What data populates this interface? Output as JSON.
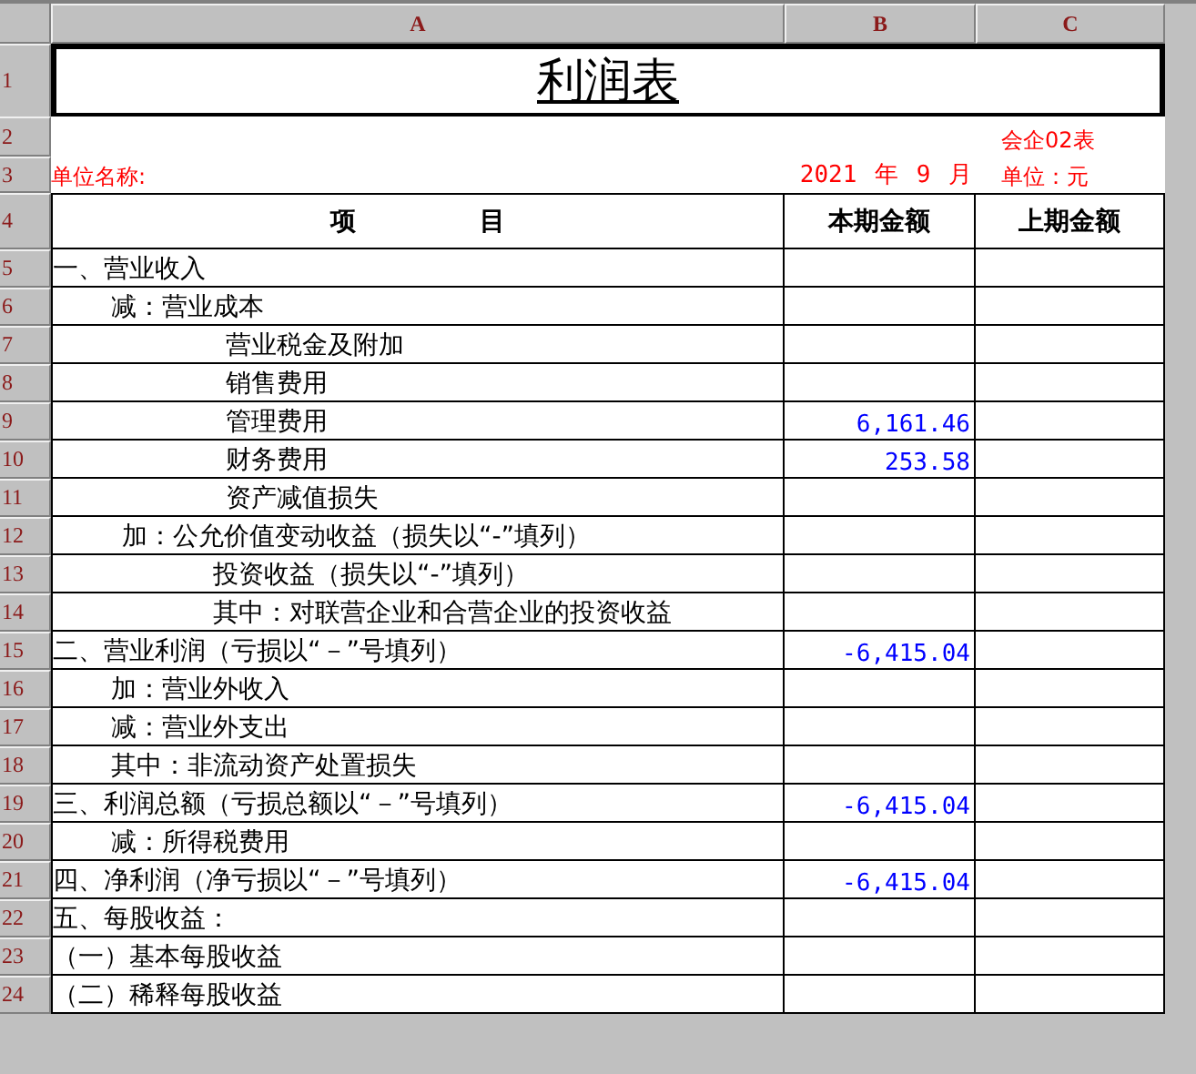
{
  "sheet": {
    "columns": [
      "A",
      "B",
      "C"
    ],
    "title_row": {
      "number": "1",
      "text": "利润表"
    },
    "form_row": {
      "number": "2",
      "form_code": "会企02表"
    },
    "info_row": {
      "number": "3",
      "company_label": "单位名称:",
      "period": "2021 年 9 月",
      "unit": "单位：元"
    },
    "header_row": {
      "number": "4",
      "item": "项 目",
      "current": "本期金额",
      "previous": "上期金额"
    },
    "rows": [
      {
        "number": "5",
        "kind": "heading",
        "item": "一、营业收入"
      },
      {
        "number": "6",
        "kind": "sub",
        "item": "减：营业成本"
      },
      {
        "number": "7",
        "kind": "detail",
        "item": "营业税金及附加"
      },
      {
        "number": "8",
        "kind": "detail",
        "item": "销售费用"
      },
      {
        "number": "9",
        "kind": "detail",
        "item": "管理费用",
        "current": "6,161.46"
      },
      {
        "number": "10",
        "kind": "detail",
        "item": "财务费用",
        "current": "253.58"
      },
      {
        "number": "11",
        "kind": "detail",
        "item": "资产减值损失"
      },
      {
        "number": "12",
        "kind": "adjust",
        "item": "加：公允价值变动收益（损失以“-”填列）"
      },
      {
        "number": "13",
        "kind": "note",
        "item": "投资收益（损失以“-”填列）"
      },
      {
        "number": "14",
        "kind": "note",
        "item": "其中：对联营企业和合营企业的投资收益"
      },
      {
        "number": "15",
        "kind": "heading",
        "item": "二、营业利润（亏损以“－”号填列）",
        "current": "-6,415.04"
      },
      {
        "number": "16",
        "kind": "sub",
        "item": "加：营业外收入"
      },
      {
        "number": "17",
        "kind": "sub",
        "item": "减：营业外支出"
      },
      {
        "number": "18",
        "kind": "sub",
        "item": "其中：非流动资产处置损失"
      },
      {
        "number": "19",
        "kind": "heading",
        "item": "三、利润总额（亏损总额以“－”号填列）",
        "current": "-6,415.04"
      },
      {
        "number": "20",
        "kind": "sub",
        "item": "减：所得税费用"
      },
      {
        "number": "21",
        "kind": "heading",
        "item": "四、净利润（净亏损以“－”号填列）",
        "current": "-6,415.04"
      },
      {
        "number": "22",
        "kind": "heading",
        "item": "五、每股收益："
      },
      {
        "number": "23",
        "kind": "heading",
        "item": "（一）基本每股收益"
      },
      {
        "number": "24",
        "kind": "heading",
        "item": "（二）稀释每股收益"
      }
    ]
  }
}
